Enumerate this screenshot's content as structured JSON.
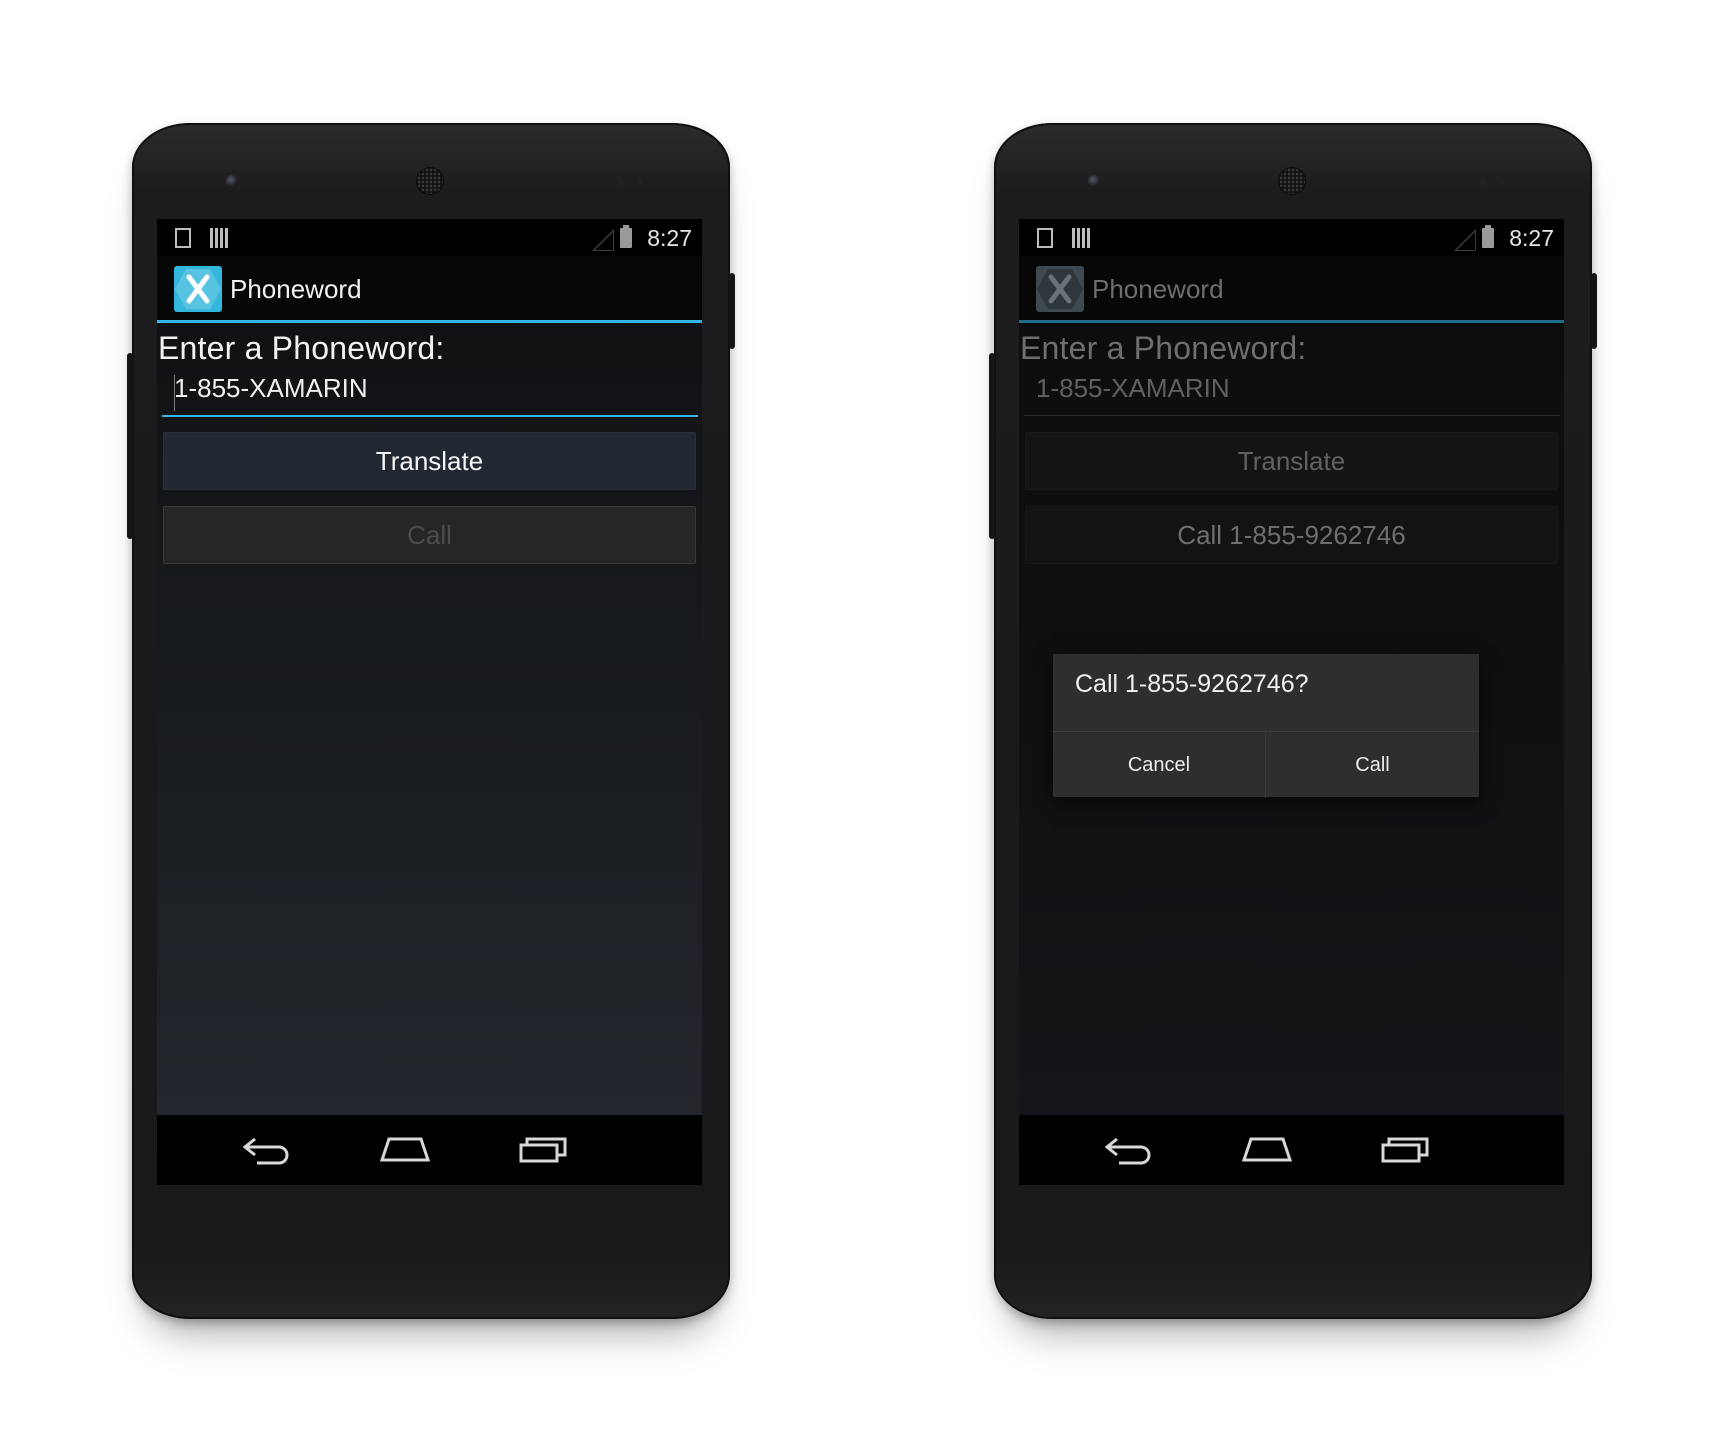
{
  "screens": [
    {
      "id": "left",
      "status_bar": {
        "time": "8:27",
        "icons": [
          "download-icon",
          "barcode-icon",
          "signal-icon",
          "battery-charging-icon"
        ]
      },
      "app": {
        "title": "Phoneword",
        "icon": "xamarin-logo-icon"
      },
      "prompt_label": "Enter a Phoneword:",
      "phoneword_input": {
        "value": "1-855-XAMARIN"
      },
      "translate_button": "Translate",
      "call_button": "Call",
      "nav": [
        "back-icon",
        "home-icon",
        "recent-apps-icon"
      ]
    },
    {
      "id": "right",
      "status_bar": {
        "time": "8:27",
        "icons": [
          "download-icon",
          "barcode-icon",
          "signal-icon",
          "battery-charging-icon"
        ]
      },
      "app": {
        "title": "Phoneword",
        "icon": "xamarin-logo-icon"
      },
      "prompt_label": "Enter a Phoneword:",
      "phoneword_input": {
        "value": "1-855-XAMARIN"
      },
      "translate_button": "Translate",
      "call_button": "Call 1-855-9262746",
      "dialog": {
        "message": "Call 1-855-9262746?",
        "cancel": "Cancel",
        "confirm": "Call"
      },
      "nav": [
        "back-icon",
        "home-icon",
        "recent-apps-icon"
      ]
    }
  ],
  "colors": {
    "accent": "#33b5e5",
    "app_icon": "#34b7dc",
    "screen_bg": "#171a1e"
  }
}
